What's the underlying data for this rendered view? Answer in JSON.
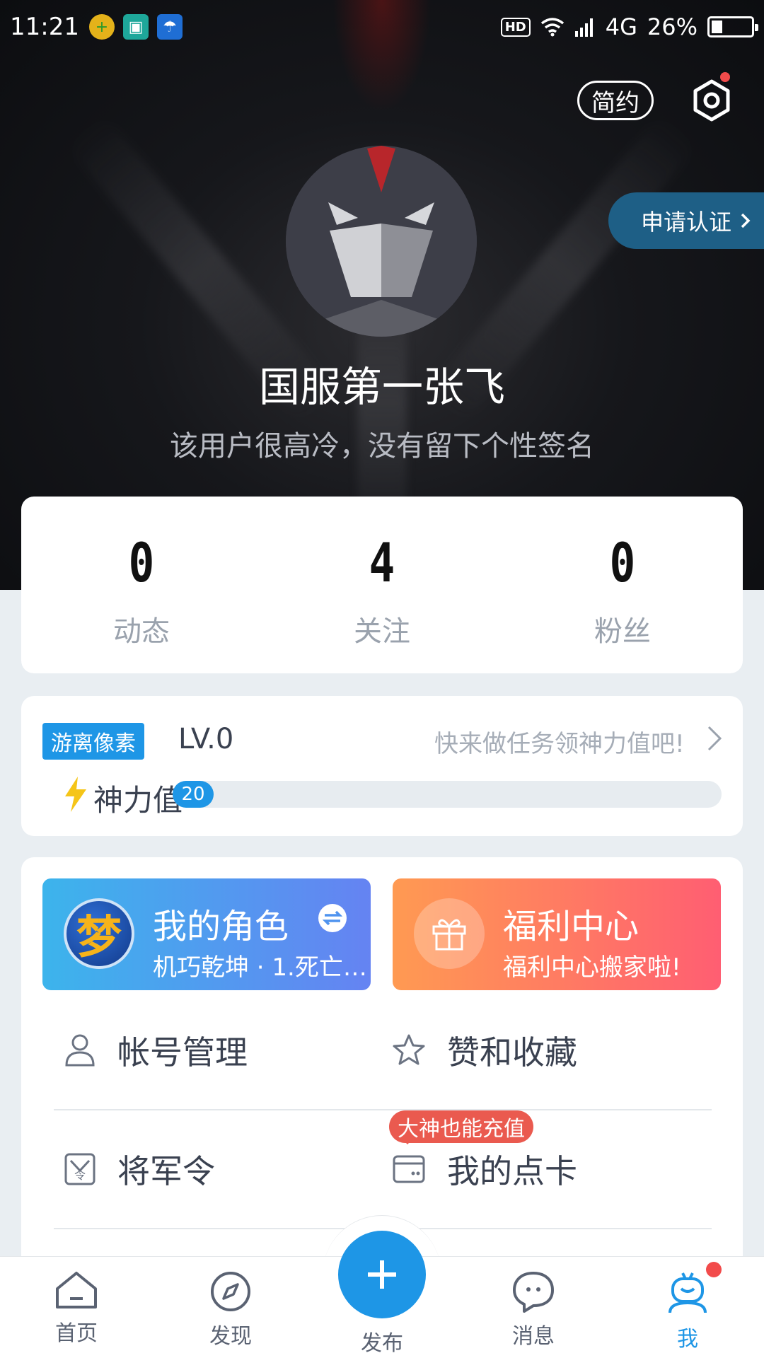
{
  "status_bar": {
    "time": "11:21",
    "hd": "HD",
    "network": "4G",
    "battery": "26%"
  },
  "header": {
    "simple_mode": "简约",
    "certify": "申请认证",
    "username": "国服第一张飞",
    "bio": "该用户很高冷，没有留下个性签名"
  },
  "stats": [
    {
      "value": "0",
      "label": "动态"
    },
    {
      "value": "4",
      "label": "关注"
    },
    {
      "value": "0",
      "label": "粉丝"
    }
  ],
  "level": {
    "tag": "游离像素",
    "level": "LV.0",
    "hint": "快来做任务领神力值吧!",
    "power_label": "神力值",
    "power_value": "20",
    "power_fraction": 0.07
  },
  "quick": {
    "role_title": "我的角色",
    "role_sub": "机巧乾坤 · 1.死亡…",
    "role_logo_char": "梦",
    "welfare_title": "福利中心",
    "welfare_sub": "福利中心搬家啦!"
  },
  "menu": {
    "account": "帐号管理",
    "likes": "赞和收藏",
    "token": "将军令",
    "token_icon_char": "令",
    "card": "我的点卡",
    "promo": "大神也能充值"
  },
  "nav": {
    "home": "首页",
    "discover": "发现",
    "publish": "发布",
    "messages": "消息",
    "me": "我"
  },
  "colors": {
    "accent": "#1e96e6",
    "cert_bg": "#1e5f86",
    "badge_red": "#f24b4b"
  }
}
